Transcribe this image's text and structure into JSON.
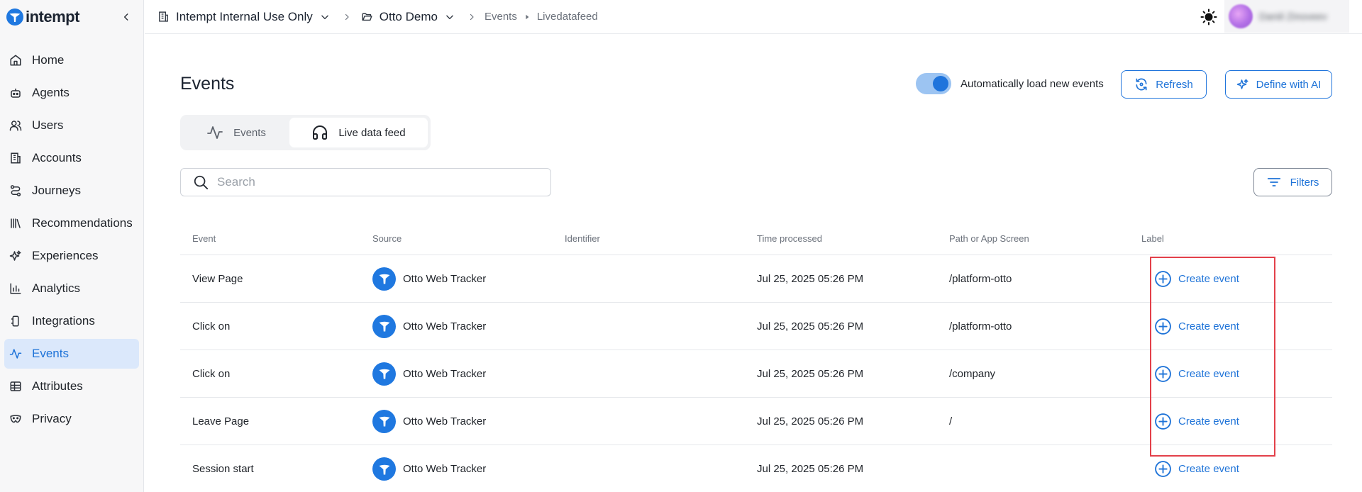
{
  "app": {
    "name": "intempt"
  },
  "sidebar": {
    "items": [
      {
        "label": "Home",
        "icon": "home-icon"
      },
      {
        "label": "Agents",
        "icon": "robot-icon"
      },
      {
        "label": "Users",
        "icon": "users-icon"
      },
      {
        "label": "Accounts",
        "icon": "building-icon"
      },
      {
        "label": "Journeys",
        "icon": "route-icon"
      },
      {
        "label": "Recommendations",
        "icon": "library-icon"
      },
      {
        "label": "Experiences",
        "icon": "sparkles-icon"
      },
      {
        "label": "Analytics",
        "icon": "bar-chart-icon"
      },
      {
        "label": "Integrations",
        "icon": "plug-icon"
      },
      {
        "label": "Events",
        "icon": "activity-icon",
        "active": true
      },
      {
        "label": "Attributes",
        "icon": "table-icon"
      },
      {
        "label": "Privacy",
        "icon": "mask-icon"
      }
    ]
  },
  "topbar": {
    "workspace": "Intempt Internal Use Only",
    "project": "Otto Demo",
    "crumb_events": "Events",
    "crumb_page": "Livedatafeed",
    "user_name": "Daniil Zinoveev"
  },
  "main": {
    "title": "Events",
    "auto_load_label": "Automatically load new events",
    "auto_load_on": true,
    "refresh_label": "Refresh",
    "define_ai_label": "Define with AI",
    "tabs": [
      {
        "label": "Events",
        "active": false
      },
      {
        "label": "Live data feed",
        "active": true
      }
    ],
    "search_placeholder": "Search",
    "filters_label": "Filters",
    "table": {
      "columns": [
        "Event",
        "Source",
        "Identifier",
        "Time processed",
        "Path or App Screen",
        "Label"
      ],
      "rows": [
        {
          "event": "View Page",
          "source": "Otto Web Tracker",
          "identifier": "",
          "time": "Jul 25, 2025 05:26 PM",
          "path": "/platform-otto",
          "label": "Create event"
        },
        {
          "event": "Click on",
          "source": "Otto Web Tracker",
          "identifier": "",
          "time": "Jul 25, 2025 05:26 PM",
          "path": "/platform-otto",
          "label": "Create event"
        },
        {
          "event": "Click on",
          "source": "Otto Web Tracker",
          "identifier": "",
          "time": "Jul 25, 2025 05:26 PM",
          "path": "/company",
          "label": "Create event"
        },
        {
          "event": "Leave Page",
          "source": "Otto Web Tracker",
          "identifier": "",
          "time": "Jul 25, 2025 05:26 PM",
          "path": "/",
          "label": "Create event"
        },
        {
          "event": "Session start",
          "source": "Otto Web Tracker",
          "identifier": "",
          "time": "Jul 25, 2025 05:26 PM",
          "path": "",
          "label": "Create event"
        }
      ]
    }
  },
  "colors": {
    "accent": "#1e73d8",
    "active_nav_bg": "#dbe8fb",
    "highlight": "#e3404a"
  }
}
